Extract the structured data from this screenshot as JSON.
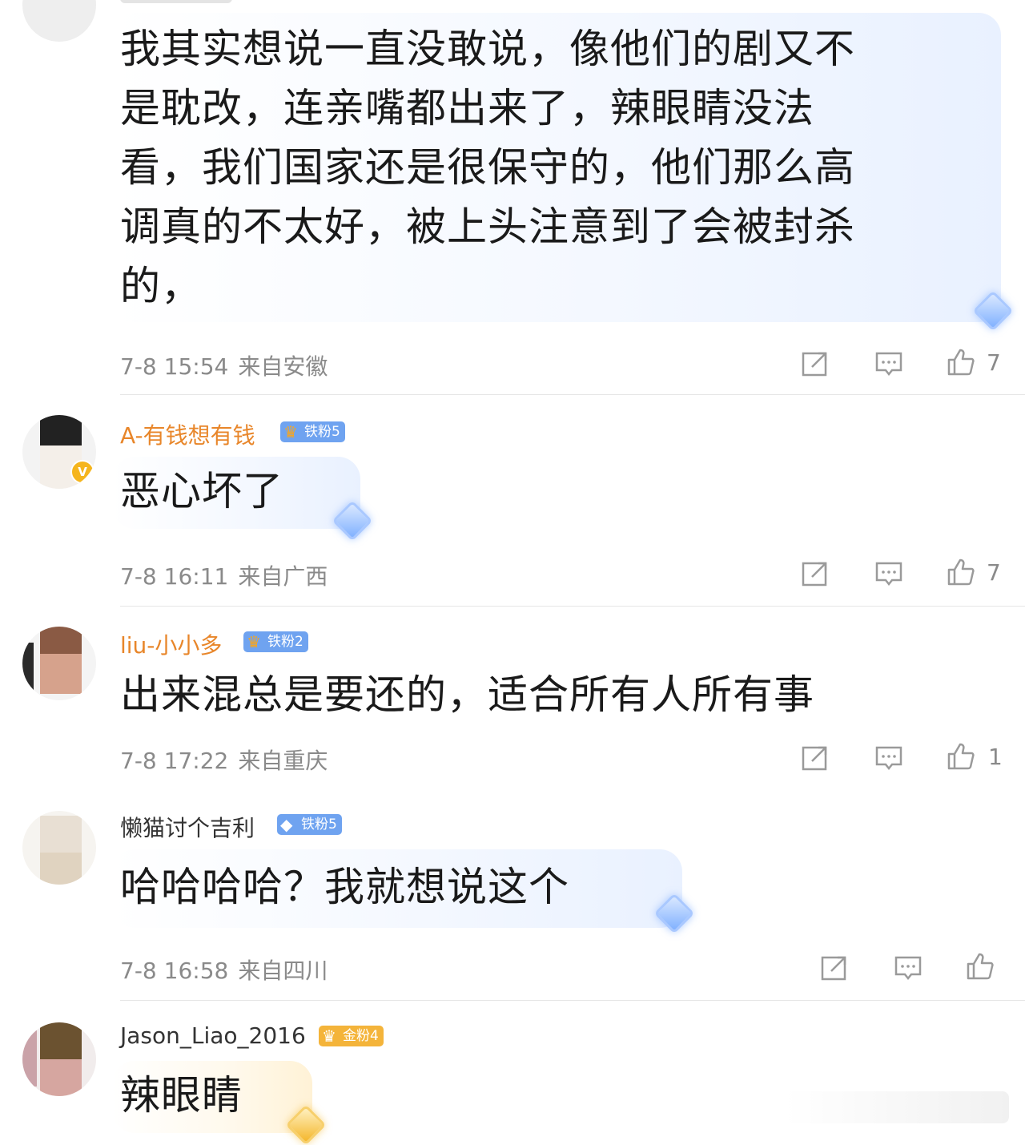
{
  "comments": [
    {
      "text_lines": [
        "我其实想说一直没敢说，像他们的剧又不",
        "是耽改，连亲嘴都出来了，辣眼睛没法",
        "看，我们国家还是很保守的，他们那么高",
        "调真的不太好，被上头注意到了会被封杀",
        "的，"
      ],
      "time": "7-8 15:54",
      "location": "来自安徽",
      "likes": "7"
    },
    {
      "username": "A-有钱想有钱",
      "badge": "铁粉5",
      "text": "恶心坏了",
      "time": "7-8 16:11",
      "location": "来自广西",
      "likes": "7"
    },
    {
      "username": "liu-小小多",
      "badge": "铁粉2",
      "text": "出来混总是要还的，适合所有人所有事",
      "time": "7-8 17:22",
      "location": "来自重庆",
      "likes": "1"
    },
    {
      "username": "懒猫讨个吉利",
      "badge": "铁粉5",
      "text": "哈哈哈哈？我就想说这个",
      "time": "7-8 16:58",
      "location": "来自四川",
      "likes": ""
    },
    {
      "username": "Jason_Liao_2016",
      "badge": "金粉4",
      "text": "辣眼睛"
    }
  ],
  "colors": {
    "username_orange": "#e8862a",
    "fan_badge_blue": "#6fa3f0",
    "fan_badge_gold": "#f4b43a",
    "meta_gray": "#8a8a8a"
  }
}
